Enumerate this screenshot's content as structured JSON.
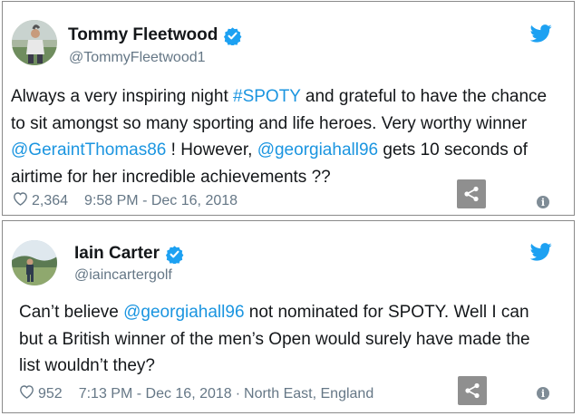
{
  "colors": {
    "link": "#1b95e0",
    "muted": "#657786",
    "text": "#14171a",
    "verified": "#1da1f2",
    "twitter": "#1da1f2"
  },
  "tweets": [
    {
      "name": "Tommy Fleetwood",
      "handle": "@TommyFleetwood1",
      "icons": [
        "avatar",
        "verified-badge-icon",
        "twitter-bird-icon",
        "heart-icon",
        "share-icon",
        "info-icon"
      ],
      "text": {
        "s1": "Always a very inspiring night ",
        "l1": "#SPOTY",
        "s2": " and grateful to have the chance to sit amongst so many sporting and life heroes. Very worthy winner ",
        "l2": "@GeraintThomas86",
        "s3": " ! However, ",
        "l3": "@georgiahall96",
        "s4": " gets 10 seconds of airtime for her incredible achievements ??"
      },
      "likes": "2,364",
      "time": "9:58 PM - Dec 16, 2018",
      "location": ""
    },
    {
      "name": "Iain Carter",
      "handle": "@iaincartergolf",
      "icons": [
        "avatar",
        "verified-badge-icon",
        "twitter-bird-icon",
        "heart-icon",
        "share-icon",
        "info-icon"
      ],
      "text": {
        "s1": "Can’t believe ",
        "l1": "@georgiahall96",
        "s2": " not nominated for SPOTY. Well I can but a British winner of the men’s Open would surely have made the list wouldn’t they?"
      },
      "likes": "952",
      "time": "7:13 PM - Dec 16, 2018",
      "separator": "·",
      "location": "North East, England"
    }
  ]
}
